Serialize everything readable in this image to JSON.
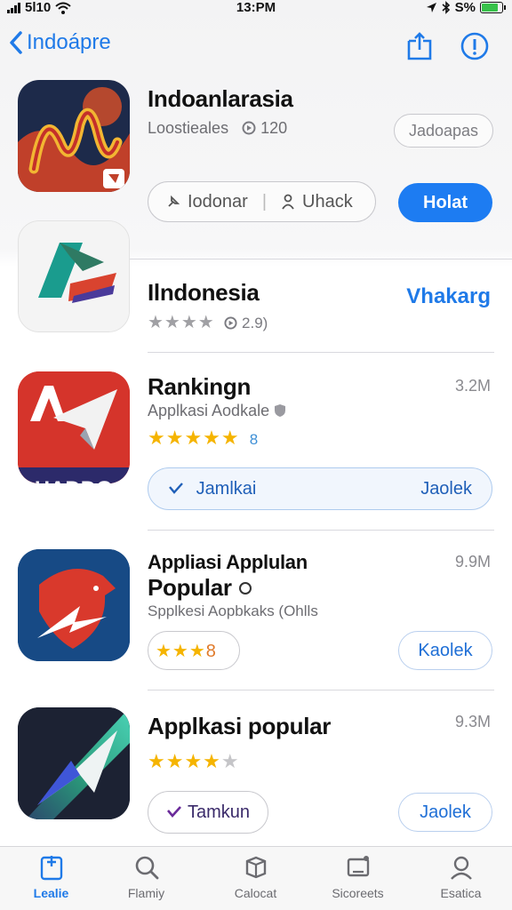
{
  "status_bar": {
    "carrier": "5l10",
    "time": "13:PM",
    "battery": "S%"
  },
  "nav": {
    "back_label": "Indoápre"
  },
  "featured": {
    "title": "Indoanlarasia",
    "subtitle": "Loostieales",
    "rating_count": "120",
    "secondary_button": "Jadoapas",
    "action_left": "Iodonar",
    "action_right": "Uhack",
    "primary_button": "Holat"
  },
  "apps": [
    {
      "title": "Ilndonesia",
      "rating_count": "2.9)",
      "action": "Vhakarg"
    },
    {
      "title": "Rankingn",
      "size": "3.2M",
      "subtitle": "Applkasi Aodkale",
      "rating_badge": "8",
      "button_left": "Jamlkai",
      "button_right": "Jaolek"
    },
    {
      "title_line1": "Appliasi Applulan",
      "title_line2": "Popular",
      "size": "9.9M",
      "subtitle": "Spplkesi Aopbkaks (Ohlls",
      "rating_badge": "8",
      "button": "Kaolek"
    },
    {
      "title": "Applkasi popular",
      "size": "9.3M",
      "button_left": "Tamkun",
      "button_right": "Jaolek"
    }
  ],
  "tabs": [
    {
      "label": "Lealie",
      "icon": "today-icon",
      "active": true
    },
    {
      "label": "Flamiy",
      "icon": "search-icon"
    },
    {
      "label": "Calocat",
      "icon": "apps-icon"
    },
    {
      "label": "Sicoreets",
      "icon": "arcade-icon"
    },
    {
      "label": "Esatica",
      "icon": "profile-icon"
    }
  ],
  "colors": {
    "accent": "#1f7ae8",
    "star": "#f5b400"
  }
}
